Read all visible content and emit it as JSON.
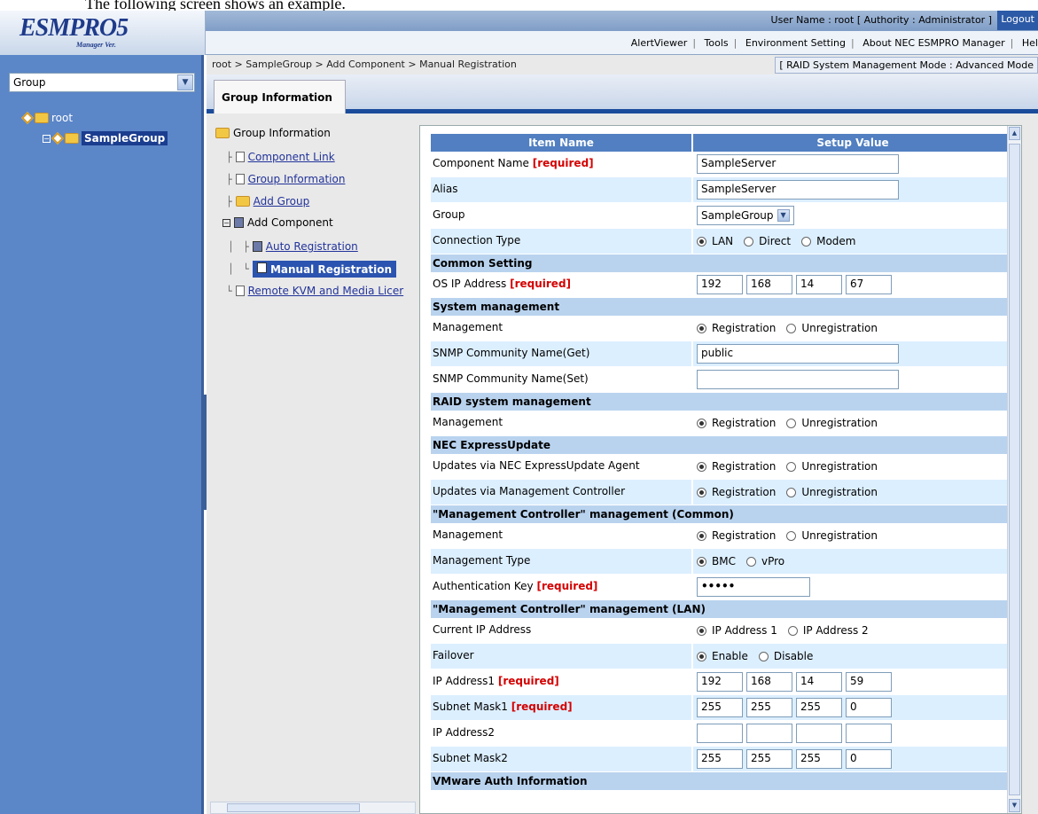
{
  "caption": "The following screen shows an example.",
  "header": {
    "logo": "ESMPRO5",
    "logo_sub": "Manager Ver.",
    "user_info": "User Name : root  [ Authority : Administrator ]",
    "logout": "Logout",
    "links": [
      "AlertViewer",
      "Tools",
      "Environment Setting",
      "About NEC ESMPRO Manager",
      "Hel"
    ]
  },
  "left": {
    "group_select": "Group",
    "tree_root": "root",
    "tree_child": "SampleGroup"
  },
  "main": {
    "breadcrumb": "root > SampleGroup > Add Component > Manual Registration",
    "mode": "[ RAID System Management Mode : Advanced Mode",
    "tab": "Group Information"
  },
  "nav": {
    "root": "Group Information",
    "items": [
      "Component Link",
      "Group Information",
      "Add Group"
    ],
    "add_component": "Add Component",
    "auto_registration": "Auto Registration",
    "manual_registration": "Manual Registration",
    "remote_kvm": "Remote KVM and Media Licer"
  },
  "grid": {
    "col_item": "Item Name",
    "col_value": "Setup Value",
    "required": "[required]",
    "component_name_label": "Component Name",
    "component_name_value": "SampleServer",
    "alias_label": "Alias",
    "alias_value": "SampleServer",
    "group_label": "Group",
    "group_value": "SampleGroup",
    "connection_label": "Connection Type",
    "conn_lan": "LAN",
    "conn_direct": "Direct",
    "conn_modem": "Modem",
    "common_setting": "Common Setting",
    "os_ip_label": "OS IP Address",
    "os_ip": [
      "192",
      "168",
      "14",
      "67"
    ],
    "system_management": "System management",
    "management_label": "Management",
    "registration": "Registration",
    "unregistration": "Unregistration",
    "snmp_get_label": "SNMP Community Name(Get)",
    "snmp_get_value": "public",
    "snmp_set_label": "SNMP Community Name(Set)",
    "snmp_set_value": "",
    "raid_management": "RAID system management",
    "express_update": "NEC ExpressUpdate",
    "updates_agent_label": "Updates via NEC ExpressUpdate Agent",
    "updates_mc_label": "Updates via Management Controller",
    "mc_common": "\"Management Controller\" management (Common)",
    "mgmt_type_label": "Management Type",
    "bmc": "BMC",
    "vpro": "vPro",
    "auth_key_label": "Authentication Key",
    "auth_key_value": "•••••",
    "mc_lan": "\"Management Controller\" management (LAN)",
    "current_ip_label": "Current IP Address",
    "ip_address_1": "IP Address 1",
    "ip_address_2": "IP Address 2",
    "failover_label": "Failover",
    "enable": "Enable",
    "disable": "Disable",
    "ip1_label": "IP Address1",
    "ip1": [
      "192",
      "168",
      "14",
      "59"
    ],
    "mask1_label": "Subnet Mask1",
    "mask1": [
      "255",
      "255",
      "255",
      "0"
    ],
    "ip2_label": "IP Address2",
    "ip2": [
      "",
      "",
      "",
      ""
    ],
    "mask2_label": "Subnet Mask2",
    "mask2": [
      "255",
      "255",
      "255",
      "0"
    ],
    "vmware_auth": "VMware Auth Information"
  }
}
